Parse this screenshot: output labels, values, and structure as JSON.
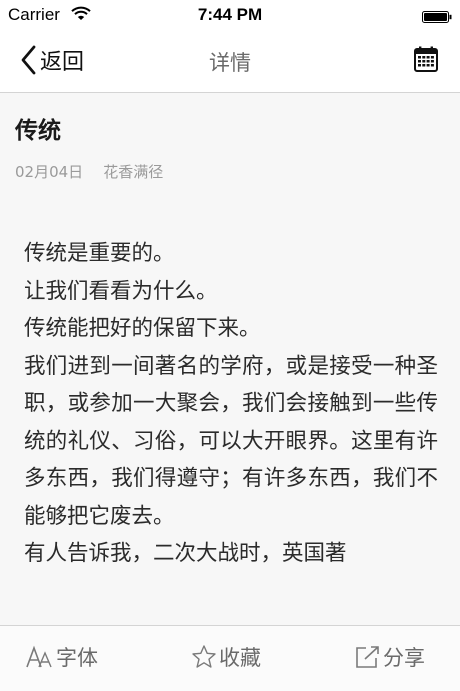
{
  "status_bar": {
    "carrier": "Carrier",
    "time": "7:44 PM"
  },
  "nav": {
    "back_label": "返回",
    "title": "详情"
  },
  "article": {
    "title": "传统",
    "date": "02月04日",
    "author": "花香满径",
    "paragraphs": [
      "传统是重要的。",
      "让我们看看为什么。",
      "传统能把好的保留下来。",
      "我们进到一间著名的学府，或是接受一种圣职，或参加一大聚会，我们会接触到一些传统的礼仪、习俗，可以大开眼界。这里有许多东西，我们得遵守；有许多东西，我们不能够把它废去。",
      "有人告诉我，二次大战时，英国著"
    ]
  },
  "toolbar": {
    "font_label": "字体",
    "favorite_label": "收藏",
    "share_label": "分享"
  },
  "icons": {
    "wifi": "wifi-icon",
    "battery": "battery-icon",
    "back": "chevron-left-icon",
    "calendar": "calendar-icon",
    "font": "font-size-icon",
    "favorite": "star-icon",
    "share": "share-icon"
  }
}
